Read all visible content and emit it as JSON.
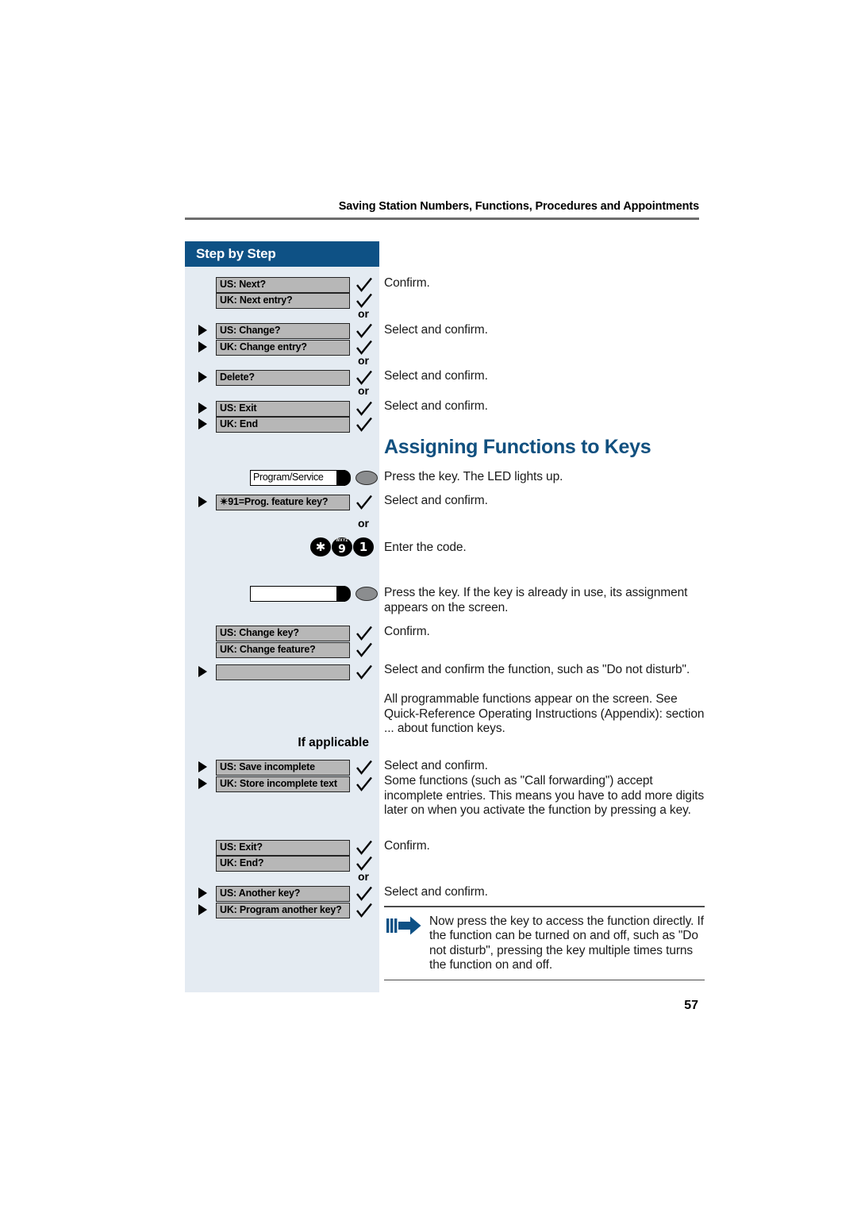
{
  "page": {
    "running_head": "Saving Station Numbers, Functions, Procedures and Appointments",
    "folio": "57"
  },
  "sidebar": {
    "header_label": "Step by Step",
    "if_applicable_label": "If applicable",
    "or_label": "or",
    "display_keys": [
      {
        "id": "us-next",
        "label": "US: Next?",
        "triangle": false,
        "check": true
      },
      {
        "id": "uk-next-entry",
        "label": "UK: Next entry?",
        "triangle": false,
        "check": true
      },
      {
        "id": "us-change",
        "label": "US: Change?",
        "triangle": true,
        "check": true
      },
      {
        "id": "uk-change-entry",
        "label": "UK: Change entry?",
        "triangle": true,
        "check": true
      },
      {
        "id": "delete",
        "label": "Delete?",
        "triangle": true,
        "check": true
      },
      {
        "id": "us-exit",
        "label": "US: Exit",
        "triangle": true,
        "check": true
      },
      {
        "id": "uk-end",
        "label": "UK: End",
        "triangle": true,
        "check": true
      },
      {
        "id": "prog-feature-key",
        "label": "✴91=Prog. feature key?",
        "triangle": true,
        "check": true
      },
      {
        "id": "us-change-key",
        "label": "US: Change key?",
        "triangle": false,
        "check": true
      },
      {
        "id": "uk-change-feature",
        "label": "UK: Change feature?",
        "triangle": false,
        "check": true
      },
      {
        "id": "blank-function",
        "label": "",
        "triangle": true,
        "check": true
      },
      {
        "id": "us-save-incomplete",
        "label": "US: Save incomplete",
        "triangle": true,
        "check": true
      },
      {
        "id": "uk-store-incomplete",
        "label": "UK: Store incomplete text",
        "triangle": true,
        "check": true
      },
      {
        "id": "us-exit-q",
        "label": "US: Exit?",
        "triangle": false,
        "check": true
      },
      {
        "id": "uk-end-q",
        "label": "UK: End?",
        "triangle": false,
        "check": true
      },
      {
        "id": "us-another-key",
        "label": "US: Another key?",
        "triangle": true,
        "check": true
      },
      {
        "id": "uk-program-another-key",
        "label": "UK: Program another key?",
        "triangle": true,
        "check": true
      }
    ],
    "function_keys": [
      {
        "id": "program-service",
        "label": "Program/Service"
      },
      {
        "id": "blank-key",
        "label": ""
      }
    ],
    "keypad": [
      {
        "id": "star",
        "glyph": "✱",
        "letters": ""
      },
      {
        "id": "nine",
        "glyph": "9",
        "letters": "WXYZ"
      },
      {
        "id": "one",
        "glyph": "1",
        "letters": ""
      }
    ]
  },
  "content": {
    "heading": "Assigning Functions to Keys",
    "paragraphs": [
      {
        "id": "p-confirm-1",
        "text": "Confirm."
      },
      {
        "id": "p-select-1",
        "text": "Select and confirm."
      },
      {
        "id": "p-select-2",
        "text": "Select and confirm."
      },
      {
        "id": "p-select-3",
        "text": "Select and confirm."
      },
      {
        "id": "p-press-led",
        "text": "Press the key. The LED lights up."
      },
      {
        "id": "p-select-4",
        "text": "Select and confirm."
      },
      {
        "id": "p-enter-code",
        "text": "Enter the code."
      },
      {
        "id": "p-press-inuse",
        "text": "Press the key. If the key is already in use, its assignment appears on the screen."
      },
      {
        "id": "p-confirm-2",
        "text": "Confirm."
      },
      {
        "id": "p-select-function",
        "text": "Select and confirm the function, such as \"Do not disturb\"."
      },
      {
        "id": "p-all-programmable",
        "text": "All programmable functions appear on the screen. See Quick-Reference Operating Instructions (Appendix): section ... about function keys."
      },
      {
        "id": "p-select-5",
        "text": "Select and confirm."
      },
      {
        "id": "p-some-functions",
        "text": "Some functions (such as \"Call forwarding\") accept incomplete entries. This means you have to add more digits later on when you activate the function by pressing a key."
      },
      {
        "id": "p-confirm-3",
        "text": "Confirm."
      },
      {
        "id": "p-select-6",
        "text": "Select and confirm."
      }
    ],
    "note": {
      "text": "Now press the key to access the function directly. If the function can be turned on and off, such as \"Do not disturb\", pressing the key multiple times turns the function on and off."
    }
  },
  "colors": {
    "brand_blue": "#0e5185",
    "heading_blue": "#11507f",
    "sidebar_bg": "#e4ebf2",
    "key_gray": "#b7b7b7",
    "led_gray": "#8b8d8f"
  }
}
